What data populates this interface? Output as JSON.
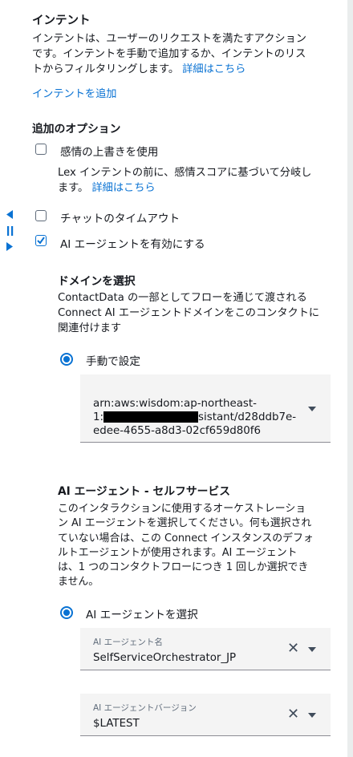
{
  "intent": {
    "title": "インテント",
    "desc_line1": "インテントは、ユーザーのリクエストを満たすアクション",
    "desc_line2": "です。インテントを手動で追加するか、インテントのリス",
    "desc_line3": "トからフィルタリングします。",
    "details_link": "詳細はこちら",
    "add_link": "インテントを追加"
  },
  "additional_options": {
    "title": "追加のオプション",
    "sentiment_override": {
      "label": "感情の上書きを使用",
      "checked": false,
      "desc_line1": "Lex インテントの前に、感情スコアに基づいて分岐し",
      "desc_line2": "ます。",
      "details_link": "詳細はこちら"
    },
    "chat_timeout": {
      "label": "チャットのタイムアウト",
      "checked": false
    },
    "enable_ai_agent": {
      "label": "AI エージェントを有効にする",
      "checked": true
    }
  },
  "domain": {
    "title": "ドメインを選択",
    "desc_line1": "ContactData の一部としてフローを通じて渡される",
    "desc_line2": "Connect AI エージェントドメインをこのコンタクトに",
    "desc_line3": "関連付けます",
    "manual_label": "手動で設定",
    "arn_line1": "arn:aws:wisdom:ap-northeast-",
    "arn_line2_prefix": "1:",
    "arn_line2_suffix": "sistant/d28ddb7e-",
    "arn_line3": "edee-4655-a8d3-02cf659d80f6"
  },
  "self_service": {
    "title": "AI エージェント - セルフサービス",
    "desc_line1": "このインタラクションに使用するオーケストレーショ",
    "desc_line2": "ン AI エージェントを選択してください。何も選択され",
    "desc_line3": "ていない場合は、この Connect インスタンスのデフォ",
    "desc_line4": "ルトエージェントが使用されます。AI エージェント",
    "desc_line5": "は、1 つのコンタクトフローにつき 1 回しか選択でき",
    "desc_line6": "ません。",
    "select_label": "AI エージェントを選択",
    "agent_name_label": "AI エージェント名",
    "agent_name_value": "SelfServiceOrchestrator_JP",
    "agent_version_label": "AI エージェントバージョン",
    "agent_version_value": "$LATEST"
  },
  "icons": {
    "collapse": "left-triangle-icon",
    "drag": "drag-handle-icon",
    "expand": "right-triangle-icon",
    "clear": "clear-x-icon",
    "dropdown": "caret-down-icon",
    "check": "checkmark-icon"
  },
  "colors": {
    "link": "#0972d3",
    "text": "#16191f",
    "field_bg": "#f4f4f4"
  }
}
